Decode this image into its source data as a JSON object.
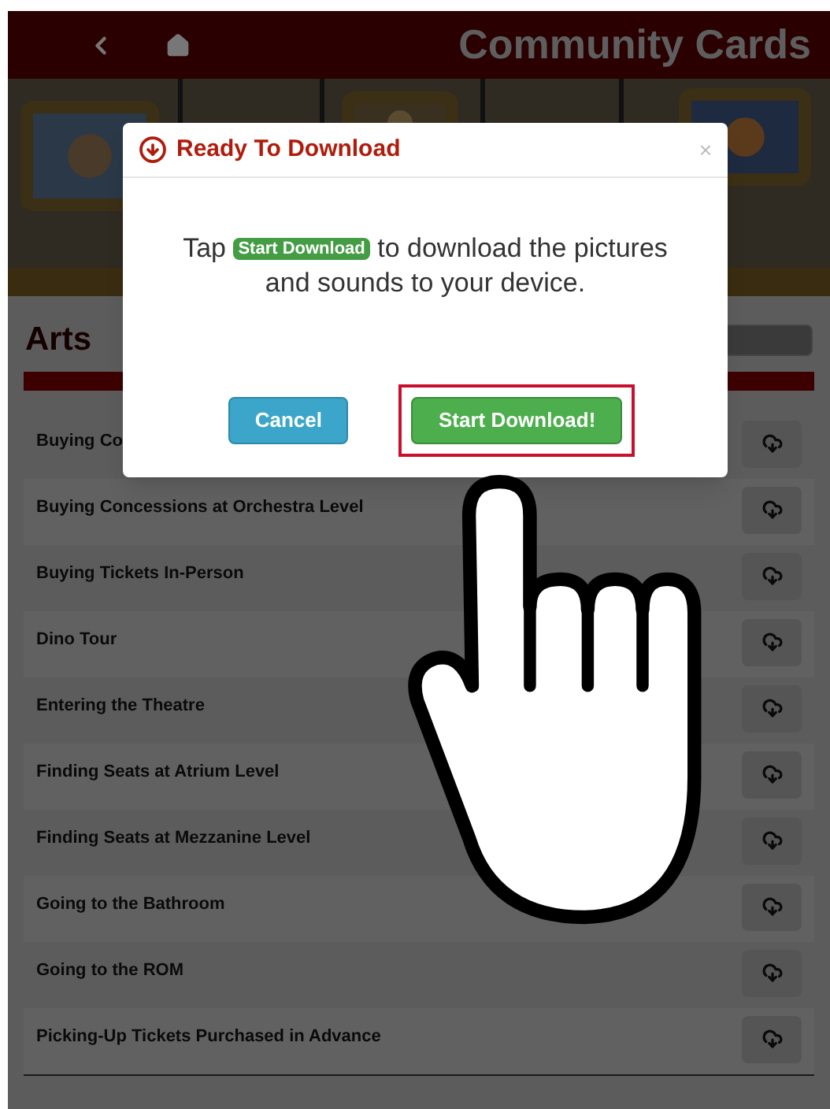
{
  "header": {
    "title": "Community Cards"
  },
  "section": {
    "title": "Arts"
  },
  "rows": [
    {
      "label": "Buying Co"
    },
    {
      "label": "Buying Concessions at Orchestra Level"
    },
    {
      "label": "Buying Tickets In-Person"
    },
    {
      "label": "Dino Tour"
    },
    {
      "label": "Entering the Theatre"
    },
    {
      "label": "Finding Seats at Atrium Level"
    },
    {
      "label": "Finding Seats at Mezzanine Level"
    },
    {
      "label": "Going to the Bathroom"
    },
    {
      "label": "Going to the ROM"
    },
    {
      "label": "Picking-Up Tickets Purchased in Advance"
    }
  ],
  "dialog": {
    "title": "Ready To Download",
    "close": "×",
    "message_before": "Tap",
    "message_badge": "Start Download",
    "message_after": "to download the pictures and sounds to your device.",
    "buttons": [
      {
        "label": "Cancel",
        "kind": "secondary",
        "highlighted": false
      },
      {
        "label": "Start Download!",
        "kind": "primary",
        "highlighted": true
      }
    ]
  }
}
